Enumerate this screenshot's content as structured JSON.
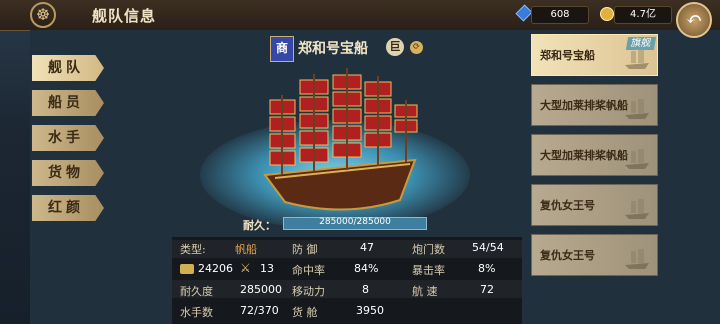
{
  "header": {
    "title": "舰队信息",
    "gems": "608",
    "gold": "4.7亿"
  },
  "tabs": [
    "舰队",
    "船员",
    "水手",
    "货物",
    "红颜"
  ],
  "ship": {
    "type_badge": "商",
    "name": "郑和号宝船",
    "size_badge": "巨",
    "durability_label": "耐久：",
    "durability_value": "285000/285000",
    "durability_fraction": 1.0
  },
  "stats": {
    "type_label": "类型:",
    "type_value": "帆船",
    "gold_value": "24206",
    "swords_value": "13",
    "durability_label": "耐久度",
    "durability_value": "285000",
    "sailors_label": "水手数",
    "sailors_value": "72/370",
    "defense_label": "防 御",
    "defense_value": "47",
    "hit_label": "命中率",
    "hit_value": "84%",
    "move_label": "移动力",
    "move_value": "8",
    "cargo_label": "货 舱",
    "cargo_value": "3950",
    "cannon_label": "炮门数",
    "cannon_value": "54/54",
    "crit_label": "暴击率",
    "crit_value": "8%",
    "speed_label": "航 速",
    "speed_value": "72"
  },
  "ship_list": [
    {
      "name": "郑和号宝船",
      "badge": "旗舰",
      "active": true
    },
    {
      "name": "大型加莱排桨帆船",
      "badge": "",
      "active": false
    },
    {
      "name": "大型加莱排桨帆船",
      "badge": "",
      "active": false
    },
    {
      "name": "复仇女王号",
      "badge": "",
      "active": false
    },
    {
      "name": "复仇女王号",
      "badge": "",
      "active": false
    }
  ],
  "colors": {
    "accent": "#e6a448",
    "gem": "#3a7cd8",
    "gold": "#e0b040"
  }
}
